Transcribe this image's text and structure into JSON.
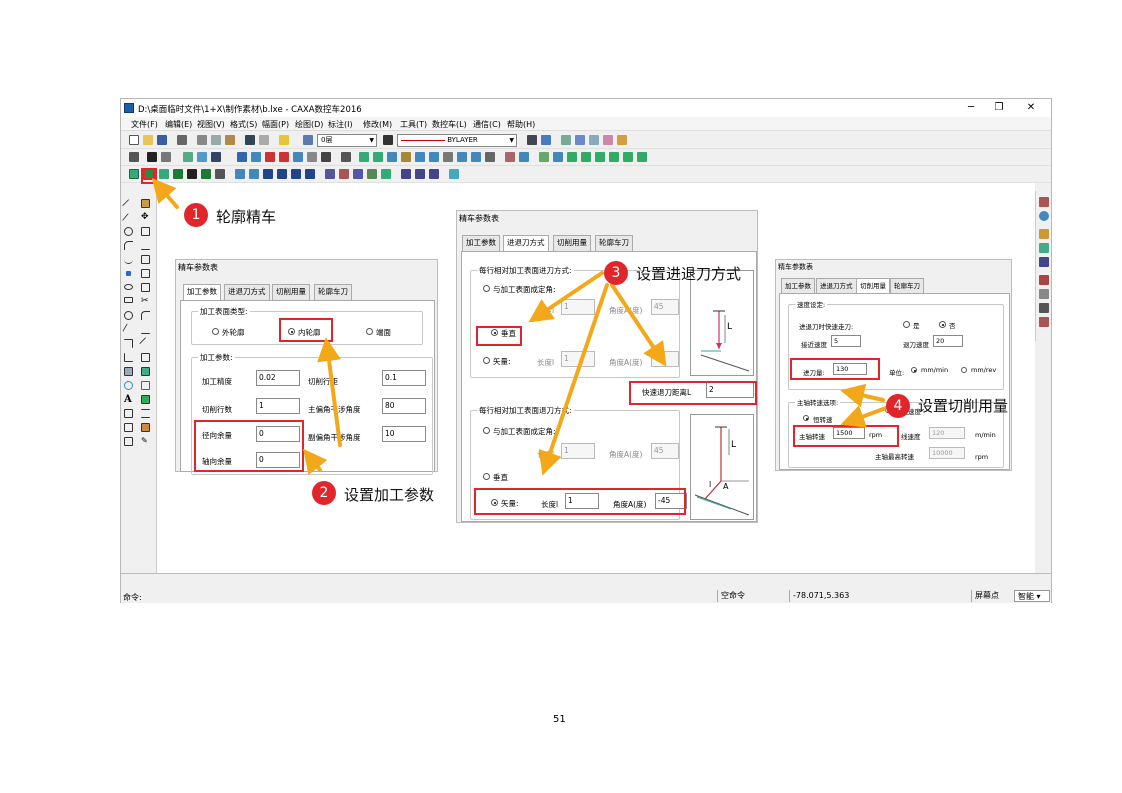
{
  "window": {
    "title": "D:\\桌面临时文件\\1+X\\制作素材\\b.lxe - CAXA数控车2016",
    "min": "─",
    "restore": "❐",
    "close": "✕"
  },
  "menu": [
    "文件(F)",
    "编辑(E)",
    "视图(V)",
    "格式(S)",
    "幅面(P)",
    "绘图(D)",
    "标注(I)",
    "修改(M)",
    "工具(T)",
    "数控车(L)",
    "通信(C)",
    "帮助(H)"
  ],
  "toolbar": {
    "layer": "0层",
    "linetype": "BYLAYER"
  },
  "status": {
    "command_label": "命令:",
    "idle": "空命令",
    "coords": "-78.071,5.363",
    "snap_mode": "屏幕点",
    "smart": "智能",
    "smart_arrow": "▾"
  },
  "page_number": "51",
  "annotations": [
    {
      "num": "1",
      "text": "轮廓精车"
    },
    {
      "num": "2",
      "text": "设置加工参数"
    },
    {
      "num": "3",
      "text": "设置进退刀方式"
    },
    {
      "num": "4",
      "text": "设置切削用量"
    }
  ],
  "colors": {
    "highlight": "#e0262b",
    "arrow": "#f2a818"
  },
  "dialog1": {
    "title": "精车参数表",
    "tabs": [
      "加工参数",
      "进退刀方式",
      "切削用量",
      "轮廓车刀"
    ],
    "surface_group": "加工表面类型:",
    "surface_options": [
      "外轮廓",
      "内轮廓",
      "端面"
    ],
    "params_group": "加工参数:",
    "precision_label": "加工精度",
    "precision": "0.02",
    "pitch_label": "切削行距",
    "pitch": "0.1",
    "passes_label": "切削行数",
    "passes": "1",
    "main_angle_label": "主偏角干涉角度",
    "main_angle": "80",
    "radial_label": "径向余量",
    "radial": "0",
    "sub_angle_label": "副偏角干涉角度",
    "sub_angle": "10",
    "axial_label": "轴向余量",
    "axial": "0"
  },
  "dialog2": {
    "title": "精车参数表",
    "tabs": [
      "加工参数",
      "进退刀方式",
      "切削用量",
      "轮廓车刀"
    ],
    "approach_group": "每行相对加工表面进刀方式:",
    "retract_group": "每行相对加工表面退刀方式:",
    "opt_angle": "与加工表面成定角:",
    "opt_vertical": "垂直",
    "opt_vector": "矢量:",
    "length_label": "长度l",
    "angle_label": "角度A(度)",
    "a_len1": "1",
    "a_ang1": "45",
    "a_len2": "1",
    "a_ang2": "45",
    "r_len1": "1",
    "r_ang1": "45",
    "r_len2": "1",
    "r_ang2": "-45",
    "fast_label": "快速退刀距离L",
    "fast_value": "2",
    "diag_L": "L",
    "diag_A": "A",
    "diag_l": "l"
  },
  "dialog3": {
    "title": "精车参数表",
    "tabs": [
      "加工参数",
      "进退刀方式",
      "切削用量",
      "轮廓车刀"
    ],
    "speed_group": "速度设定:",
    "rapid_label": "进退刀时快速走刀:",
    "yes": "是",
    "no": "否",
    "approach_speed_label": "接近速度",
    "approach_speed": "5",
    "retract_speed_label": "退刀速度",
    "retract_speed": "20",
    "feed_label": "进刀量:",
    "feed": "130",
    "unit_label": "单位:",
    "unit1": "mm/min",
    "unit2": "mm/rev",
    "spindle_group": "主轴转速选项:",
    "const_speed": "恒转速",
    "const_linear": "恒线速度",
    "spindle_label": "主轴转速",
    "spindle": "1500",
    "rpm": "rpm",
    "linear_label": "线速度",
    "linear": "120",
    "linear_unit": "m/min",
    "max_label": "主轴最高转速",
    "max": "10000",
    "max_unit": "rpm"
  }
}
